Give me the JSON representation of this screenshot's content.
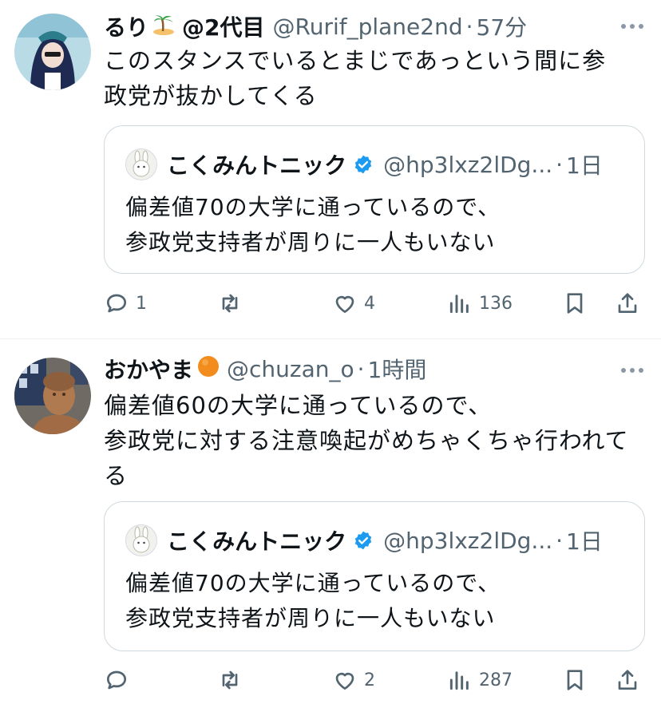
{
  "tweets": [
    {
      "name": "るり",
      "name_suffix": "@2代目",
      "handle": "@Rurif_plane2nd",
      "dot": "·",
      "time": "57分",
      "text_lines": [
        "このスタンスでいるとまじであっという間に参",
        "政党が抜かしてくる"
      ],
      "quote": {
        "name": "こくみんトニック",
        "handle": "@hp3lxz2lDg...",
        "dot": "·",
        "time": "1日",
        "text_lines": [
          "偏差値70の大学に通っているので、",
          "参政党支持者が周りに一人もいない"
        ]
      },
      "actions": {
        "replies": "1",
        "retweets": "",
        "likes": "4",
        "views": "136"
      }
    },
    {
      "name": "おかやま",
      "name_suffix": "",
      "handle": "@chuzan_o",
      "dot": "·",
      "time": "1時間",
      "text_lines": [
        "偏差値60の大学に通っているので、",
        "参政党に対する注意喚起がめちゃくちゃ行われて",
        "る"
      ],
      "quote": {
        "name": "こくみんトニック",
        "handle": "@hp3lxz2lDg...",
        "dot": "·",
        "time": "1日",
        "text_lines": [
          "偏差値70の大学に通っているので、",
          "参政党支持者が周りに一人もいない"
        ]
      },
      "actions": {
        "replies": "",
        "retweets": "",
        "likes": "2",
        "views": "287"
      }
    }
  ],
  "icons": {
    "more": "more-dots-icon",
    "reply": "reply-icon",
    "retweet": "retweet-icon",
    "like": "heart-icon",
    "views": "views-icon",
    "bookmark": "bookmark-icon",
    "share": "share-icon",
    "verified": "verified-badge-icon"
  },
  "colors": {
    "text": "#0f1419",
    "secondary": "#536471",
    "border": "#cfd9de",
    "verified": "#1d9bf0"
  }
}
